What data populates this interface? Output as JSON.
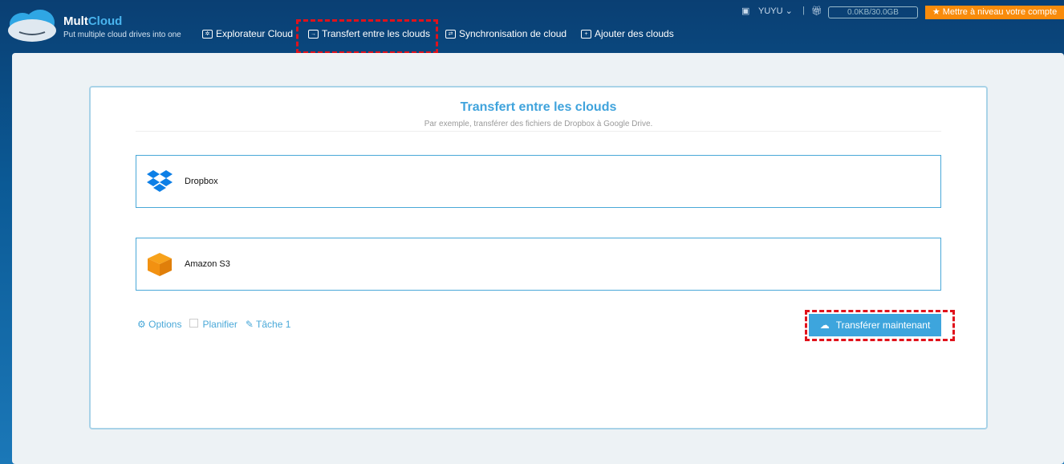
{
  "header": {
    "brand_a": "Mult",
    "brand_b": "Cloud",
    "tagline": "Put multiple cloud drives into one",
    "nav": [
      {
        "label": "Explorateur Cloud"
      },
      {
        "label": "Transfert entre les clouds"
      },
      {
        "label": "Synchronisation de cloud"
      },
      {
        "label": "Ajouter des clouds"
      }
    ],
    "user": "YUYU",
    "quota": "0.0KB/30.0GB",
    "upgrade": "★ Mettre à niveau votre compte"
  },
  "main": {
    "title": "Transfert entre les clouds",
    "subtitle": "Par exemple, transférer des fichiers de Dropbox à Google Drive.",
    "source": "Dropbox",
    "target": "Amazon S3",
    "options": "Options",
    "schedule": "Planifier",
    "task": "Tâche 1",
    "transfer_button": "Transférer maintenant"
  },
  "colors": {
    "accent": "#3da5dd",
    "upgrade": "#f98b0b",
    "highlight": "#e0121b"
  }
}
